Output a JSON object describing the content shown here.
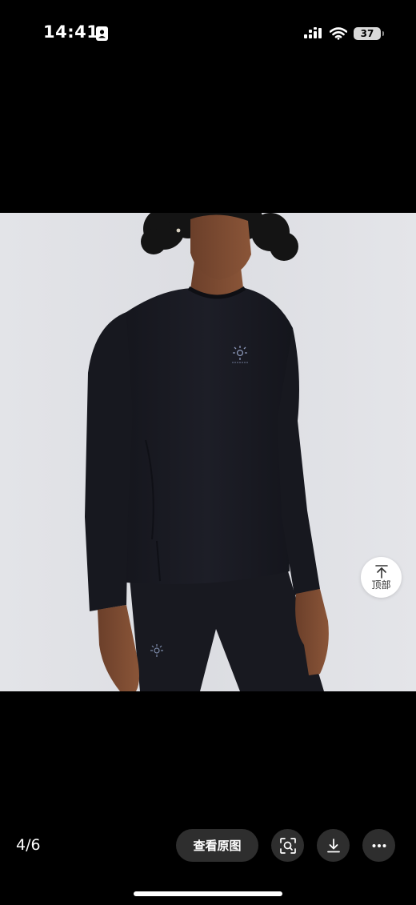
{
  "status_bar": {
    "time": "14:41",
    "contact_icon": "person-card-icon",
    "signal_icon": "cellular-signal-icon",
    "wifi_icon": "wifi-icon",
    "battery_level": "37"
  },
  "viewer": {
    "image_description_icon": "product-photo",
    "back_to_top_label": "顶部",
    "back_to_top_icon": "arrow-up-to-top-icon"
  },
  "toolbar": {
    "page_counter": "4/6",
    "view_original_label": "查看原图",
    "image_search_icon": "image-search-icon",
    "download_icon": "download-icon",
    "more_icon": "more-dots-icon"
  },
  "colors": {
    "background": "#000000",
    "button_background": "#2e2e2e",
    "photo_backdrop": "#dfe0e4",
    "shirt": "#1b1c24"
  }
}
